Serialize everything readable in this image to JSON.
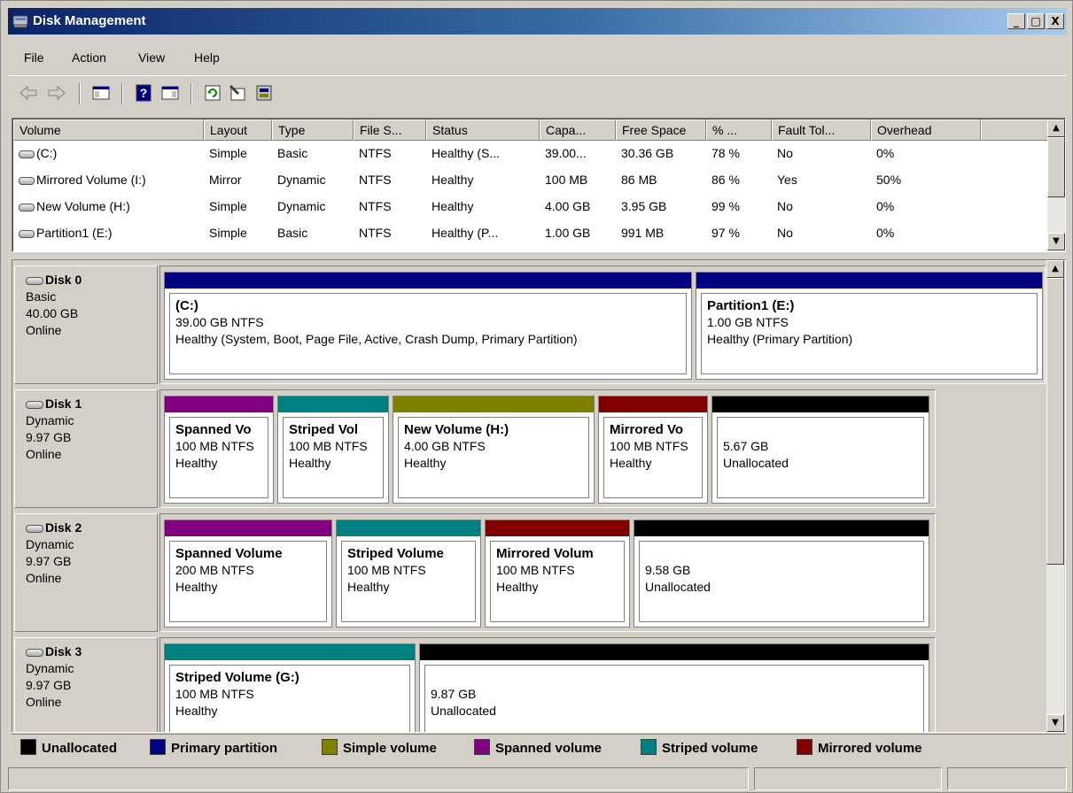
{
  "window": {
    "title": "Disk Management",
    "controls": [
      "_",
      "□",
      "X"
    ]
  },
  "menu": [
    "File",
    "Action",
    "View",
    "Help"
  ],
  "toolbar": {
    "icons": [
      "back-arrow-icon",
      "forward-arrow-icon",
      "show-hide-console-tree-icon",
      "help-icon",
      "show-hide-action-pane-icon",
      "refresh-icon",
      "properties-icon",
      "disk-management-icon"
    ]
  },
  "volume_list": {
    "columns": [
      "Volume",
      "Layout",
      "Type",
      "File S...",
      "Status",
      "Capa...",
      "Free Space",
      "% ...",
      "Fault Tol...",
      "Overhead"
    ],
    "rows": [
      {
        "volume": "(C:)",
        "layout": "Simple",
        "type": "Basic",
        "fs": "NTFS",
        "status": "Healthy (S...",
        "capacity": "39.00...",
        "free": "30.36 GB",
        "pct": "78 %",
        "fault": "No",
        "overhead": "0%"
      },
      {
        "volume": "Mirrored Volume (I:)",
        "layout": "Mirror",
        "type": "Dynamic",
        "fs": "NTFS",
        "status": "Healthy",
        "capacity": "100 MB",
        "free": "86 MB",
        "pct": "86 %",
        "fault": "Yes",
        "overhead": "50%"
      },
      {
        "volume": "New Volume (H:)",
        "layout": "Simple",
        "type": "Dynamic",
        "fs": "NTFS",
        "status": "Healthy",
        "capacity": "4.00 GB",
        "free": "3.95 GB",
        "pct": "99 %",
        "fault": "No",
        "overhead": "0%"
      },
      {
        "volume": "Partition1 (E:)",
        "layout": "Simple",
        "type": "Basic",
        "fs": "NTFS",
        "status": "Healthy (P...",
        "capacity": "1.00 GB",
        "free": "991 MB",
        "pct": "97 %",
        "fault": "No",
        "overhead": "0%"
      }
    ]
  },
  "disks": [
    {
      "name": "Disk 0",
      "type": "Basic",
      "size": "40.00 GB",
      "state": "Online",
      "partitions": [
        {
          "name": "(C:)",
          "size": "39.00 GB NTFS",
          "status": "Healthy (System, Boot, Page File, Active, Crash Dump, Primary Partition)",
          "kind": "primary"
        },
        {
          "name": "Partition1  (E:)",
          "size": "1.00 GB NTFS",
          "status": "Healthy (Primary Partition)",
          "kind": "primary"
        }
      ]
    },
    {
      "name": "Disk 1",
      "type": "Dynamic",
      "size": "9.97 GB",
      "state": "Online",
      "partitions": [
        {
          "name": "Spanned Vo",
          "size": "100 MB NTFS",
          "status": "Healthy",
          "kind": "spanned"
        },
        {
          "name": "Striped Vol",
          "size": "100 MB NTFS",
          "status": "Healthy",
          "kind": "striped"
        },
        {
          "name": "New Volume  (H:)",
          "size": "4.00 GB NTFS",
          "status": "Healthy",
          "kind": "simple"
        },
        {
          "name": "Mirrored Vo",
          "size": "100 MB NTFS",
          "status": "Healthy",
          "kind": "mirrored"
        },
        {
          "name": "",
          "size": "5.67 GB",
          "status": "Unallocated",
          "kind": "unallocated"
        }
      ]
    },
    {
      "name": "Disk 2",
      "type": "Dynamic",
      "size": "9.97 GB",
      "state": "Online",
      "partitions": [
        {
          "name": "Spanned Volume",
          "size": "200 MB NTFS",
          "status": "Healthy",
          "kind": "spanned"
        },
        {
          "name": "Striped Volume",
          "size": "100 MB NTFS",
          "status": "Healthy",
          "kind": "striped"
        },
        {
          "name": "Mirrored Volum",
          "size": "100 MB NTFS",
          "status": "Healthy",
          "kind": "mirrored"
        },
        {
          "name": "",
          "size": "9.58 GB",
          "status": "Unallocated",
          "kind": "unallocated"
        }
      ]
    },
    {
      "name": "Disk 3",
      "type": "Dynamic",
      "size": "9.97 GB",
      "state": "Online",
      "partitions": [
        {
          "name": "Striped Volume  (G:)",
          "size": "100 MB NTFS",
          "status": "Healthy",
          "kind": "striped"
        },
        {
          "name": "",
          "size": "9.87 GB",
          "status": "Unallocated",
          "kind": "unallocated"
        }
      ]
    }
  ],
  "legend": [
    {
      "label": "Unallocated",
      "color": "#000000"
    },
    {
      "label": "Primary partition",
      "color": "#000080"
    },
    {
      "label": "Simple volume",
      "color": "#808000"
    },
    {
      "label": "Spanned volume",
      "color": "#800080"
    },
    {
      "label": "Striped volume",
      "color": "#008080"
    },
    {
      "label": "Mirrored volume",
      "color": "#800000"
    }
  ]
}
